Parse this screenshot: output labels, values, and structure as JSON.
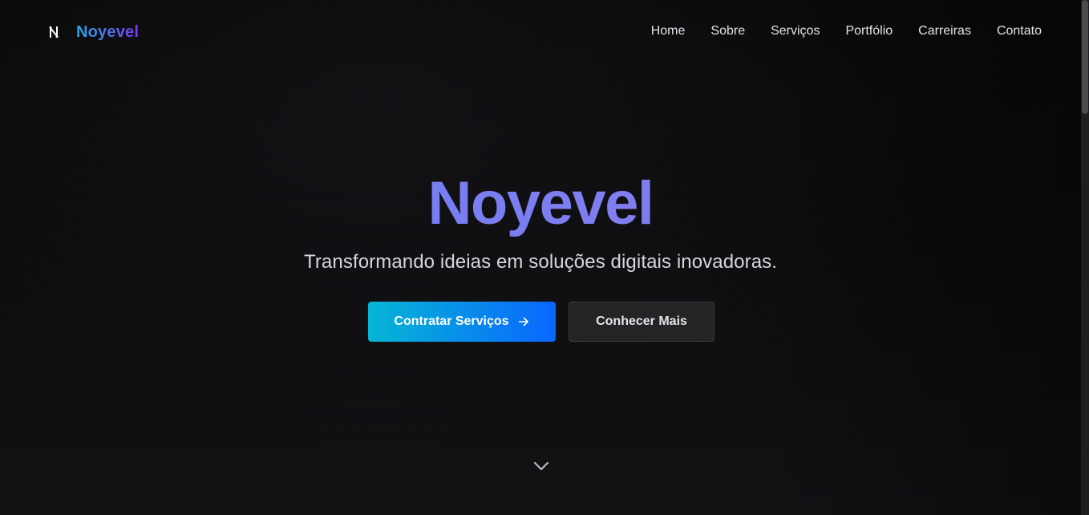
{
  "navbar": {
    "brand_name": "Noyevel",
    "logo_icon": "brand-n-icon",
    "links": [
      {
        "label": "Home"
      },
      {
        "label": "Sobre"
      },
      {
        "label": "Serviços"
      },
      {
        "label": "Portfólio"
      },
      {
        "label": "Carreiras"
      },
      {
        "label": "Contato"
      }
    ]
  },
  "hero": {
    "title": "Noyevel",
    "subtitle": "Transformando ideias em soluções digitais inovadoras.",
    "primary_cta": {
      "label": "Contratar Serviços",
      "icon": "arrow-right-icon"
    },
    "secondary_cta": {
      "label": "Conhecer Mais"
    },
    "scroll_icon": "chevron-down-icon"
  },
  "colors": {
    "background": "#0c0c0e",
    "brand_gradient_start": "#22a9e6",
    "brand_gradient_end": "#7c3aed",
    "title_gradient_start": "#5f7ff5",
    "title_gradient_end": "#8a73e8",
    "primary_button_start": "#06b6d4",
    "primary_button_end": "#0a66ff",
    "secondary_button": "#242427"
  }
}
